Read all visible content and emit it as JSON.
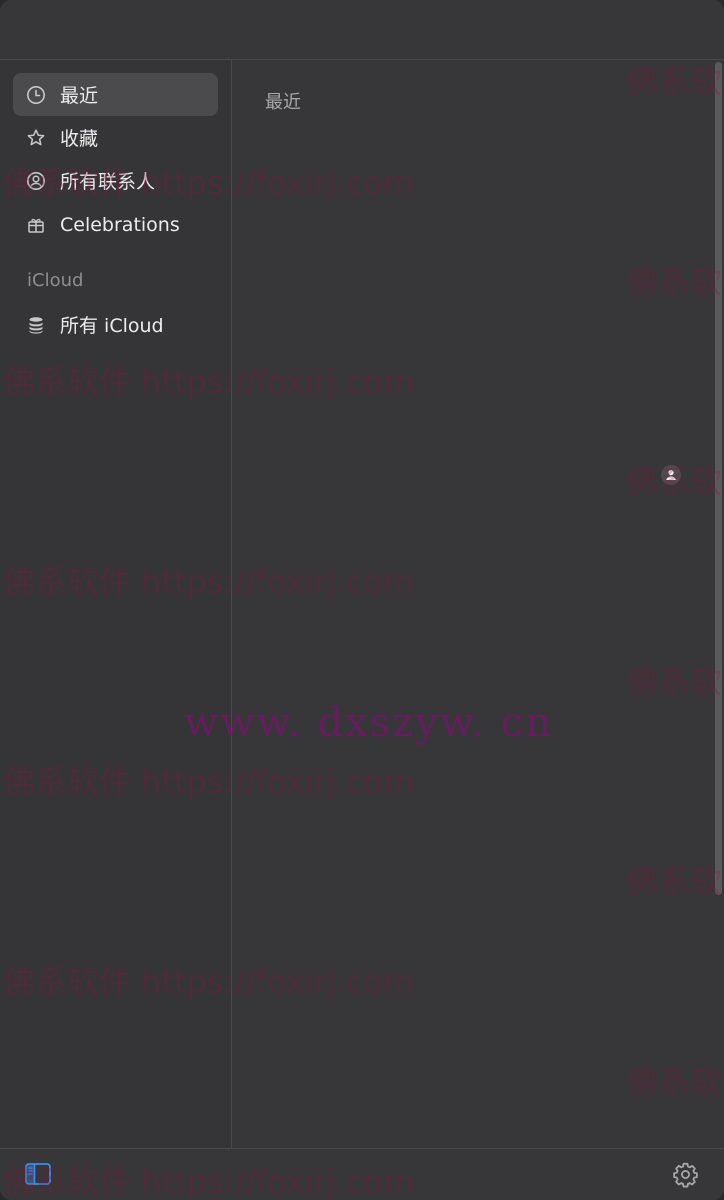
{
  "sidebar": {
    "items": [
      {
        "label": "最近",
        "icon": "clock-icon"
      },
      {
        "label": "收藏",
        "icon": "star-icon"
      },
      {
        "label": "所有联系人",
        "icon": "person-circle-icon"
      },
      {
        "label": "Celebrations",
        "icon": "gift-icon"
      }
    ],
    "section_header": "iCloud",
    "section_items": [
      {
        "label": "所有 iCloud",
        "icon": "database-icon"
      }
    ]
  },
  "content": {
    "title": "最近"
  },
  "bottombar": {
    "sidebar_toggle_icon": "sidebar-toggle-icon",
    "settings_icon": "gear-icon"
  },
  "watermarks": {
    "repeat_text": "佛系软件 https://foxirj.com",
    "edge_text": "佛系软",
    "center_text": "www. dxszyw. cn"
  },
  "colors": {
    "window_bg": "#373638",
    "selected_bg": "#4b4a4d",
    "accent": "#3f8cf0"
  }
}
